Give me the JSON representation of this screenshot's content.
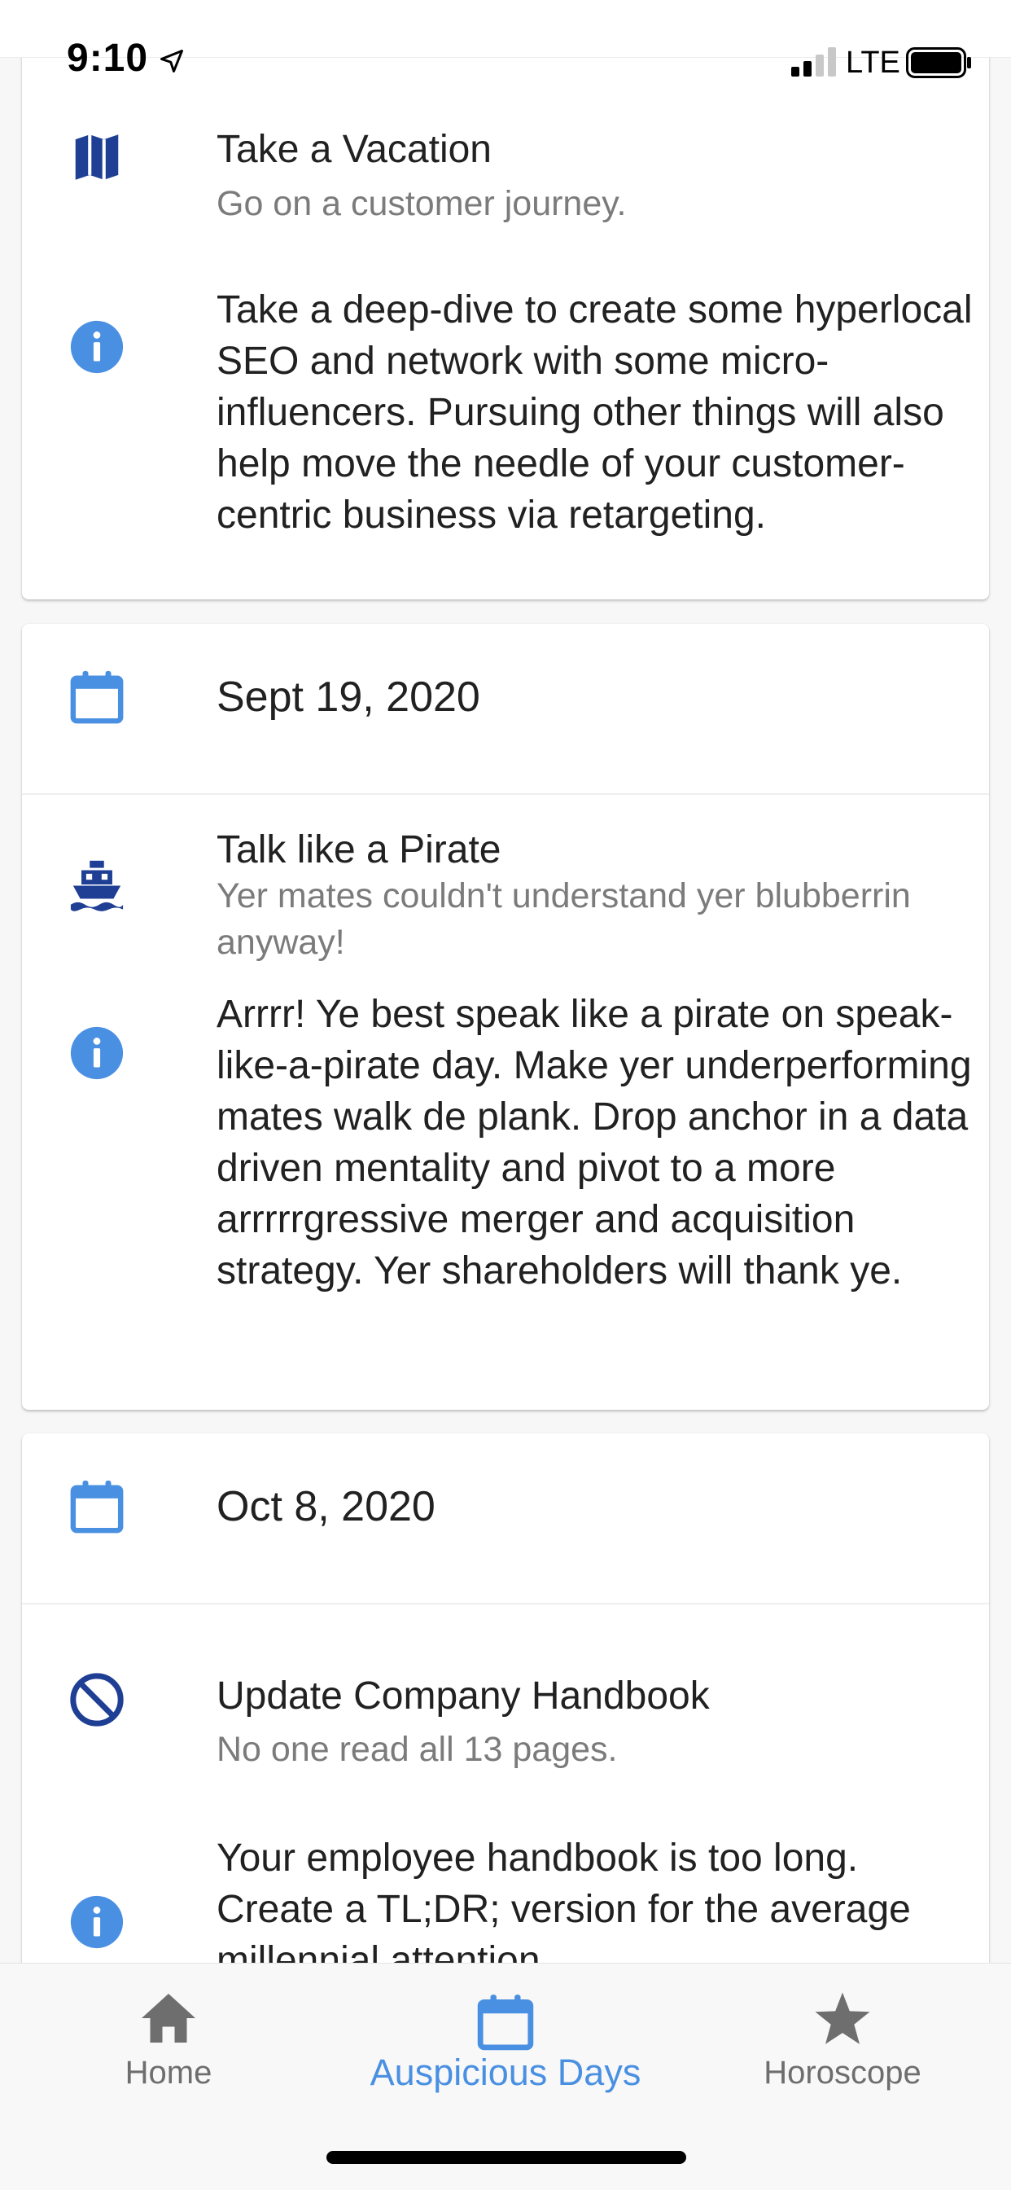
{
  "status_bar": {
    "time": "9:10",
    "network": "LTE"
  },
  "entries": [
    {
      "title": "Take a Vacation",
      "subtitle": "Go on a customer journey.",
      "icon": "map-icon",
      "description": "Take a deep-dive to create some hyperlocal SEO and network with some micro-influencers. Pursuing other things will also help move the needle of your customer-centric business via retargeting."
    },
    {
      "date": "Sept 19, 2020",
      "title": "Talk like a Pirate",
      "subtitle": "Yer mates couldn't understand yer blubberrin anyway!",
      "icon": "ship-icon",
      "description": "Arrrr! Ye best speak like a pirate on speak-like-a-pirate day. Make yer underperforming mates walk de plank. Drop anchor in a data driven mentality and pivot to a more arrrrrgressive merger and acquisition strategy. Yer shareholders will thank ye."
    },
    {
      "date": "Oct 8, 2020",
      "title": "Update Company Handbook",
      "subtitle": "No one read all 13 pages.",
      "icon": "block-icon",
      "description": "Your employee handbook is too long. Create a TL;DR; version for the average millennial attention"
    }
  ],
  "tabs": [
    {
      "label": "Home",
      "icon": "home-icon",
      "active": false
    },
    {
      "label": "Auspicious Days",
      "icon": "calendar-icon",
      "active": true
    },
    {
      "label": "Horoscope",
      "icon": "star-icon",
      "active": false
    }
  ],
  "colors": {
    "primary_blue": "#4a90e2",
    "dark_blue": "#1f3f95",
    "tab_inactive": "#6e6e6e",
    "subtitle_gray": "#7b7b7b"
  }
}
